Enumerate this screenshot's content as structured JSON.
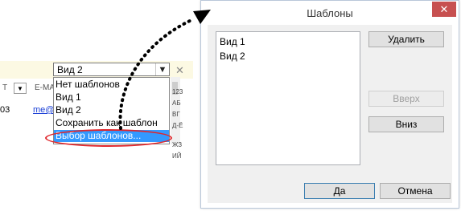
{
  "background_app": {
    "combo_value": "Вид 2",
    "combo_arrow": "chevron-down-icon",
    "close_glyph": "✕",
    "column_headers": [
      "Т",
      "E-MA"
    ],
    "row": {
      "number": "03",
      "email": "me@"
    },
    "dropdown_items": [
      "Нет шаблонов",
      "Вид 1",
      "Вид 2",
      "Сохранить как шаблон",
      "Выбор шаблонов..."
    ],
    "alphabet_index": [
      "123",
      "АБ",
      "ВГ",
      "Д-Ё",
      "ЖЗ",
      "ИЙ"
    ]
  },
  "dialog": {
    "title": "Шаблоны",
    "close_glyph": "✕",
    "list_items": [
      "Вид 1",
      "Вид 2"
    ],
    "buttons": {
      "delete": "Удалить",
      "up": "Вверх",
      "down": "Вниз",
      "ok": "Да",
      "cancel": "Отмена"
    }
  },
  "colors": {
    "highlight": "#3399ff",
    "annotation_red": "#e0262b",
    "close_red": "#c75050",
    "strip_yellow": "#fcf9e3"
  }
}
